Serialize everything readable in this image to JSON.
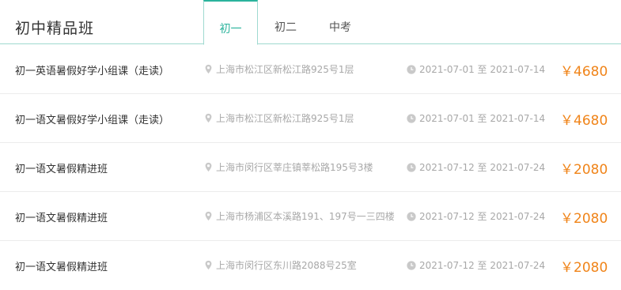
{
  "header": {
    "title": "初中精品班",
    "tabs": [
      {
        "label": "初一"
      },
      {
        "label": "初二"
      },
      {
        "label": "中考"
      }
    ]
  },
  "courses": [
    {
      "name": "初一英语暑假好学小组课（走读）",
      "address": "上海市松江区新松江路925号1层",
      "date": "2021-07-01 至 2021-07-14",
      "price": "￥4680"
    },
    {
      "name": "初一语文暑假好学小组课（走读）",
      "address": "上海市松江区新松江路925号1层",
      "date": "2021-07-01 至 2021-07-14",
      "price": "￥4680"
    },
    {
      "name": "初一语文暑假精进班",
      "address": "上海市闵行区莘庄镇莘松路195号3楼",
      "date": "2021-07-12 至 2021-07-24",
      "price": "￥2080"
    },
    {
      "name": "初一语文暑假精进班",
      "address": "上海市杨浦区本溪路191、197号一三四楼",
      "date": "2021-07-12 至 2021-07-24",
      "price": "￥2080"
    },
    {
      "name": "初一语文暑假精进班",
      "address": "上海市闵行区东川路2088号25室",
      "date": "2021-07-12 至 2021-07-24",
      "price": "￥2080"
    }
  ],
  "colors": {
    "accent": "#2ab39c",
    "price": "#f08419",
    "muted": "#a8a8a8"
  },
  "icons": {
    "address": "location-pin-icon",
    "date": "clock-icon"
  }
}
